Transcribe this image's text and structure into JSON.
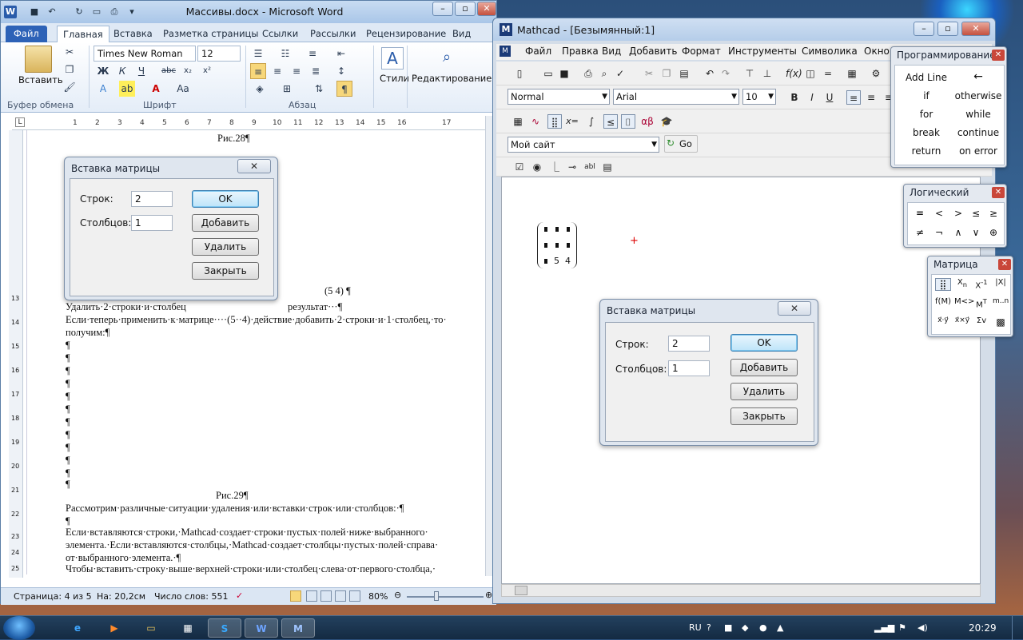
{
  "word": {
    "title": "Массивы.docx  -  Microsoft Word",
    "tabs": [
      "Файл",
      "Главная",
      "Вставка",
      "Разметка страницы",
      "Ссылки",
      "Рассылки",
      "Рецензирование",
      "Вид"
    ],
    "groups": {
      "clipboard": "Буфер обмена",
      "font": "Шрифт",
      "paragraph": "Абзац",
      "styles": "Стили",
      "editing": "Редактирование",
      "paste": "Вставить"
    },
    "font_name": "Times New Roman",
    "font_size": "12",
    "ruler_marks": [
      "1",
      "2",
      "3",
      "4",
      "5",
      "6",
      "7",
      "8",
      "9",
      "10",
      "11",
      "12",
      "13",
      "14",
      "15",
      "16",
      "17"
    ],
    "vruler_marks": [
      "13",
      "14",
      "15",
      "16",
      "17",
      "18",
      "19",
      "20",
      "21",
      "22",
      "23",
      "24",
      "25"
    ],
    "doc": {
      "fig28": "Рис.28¶",
      "matrix_expr": "(5  4)  ¶",
      "line_delete": "Удалить·2·строки·и·столбец",
      "line_result": "результат···¶",
      "line_apply": "Если·теперь·применить·к·матрице····(5··4)·действие·добавить·2·строки·и·1·столбец,·то·",
      "line_get": "получим:¶",
      "empty_para": "¶",
      "fig29": "Рис.29¶",
      "p1": "Рассмотрим·различные·ситуации·удаления·или·вставки·строк·или·столбцов:·¶",
      "p2a": "Если·вставляются·строки,·Mathcad·создает·строки·пустых·полей·ниже·выбранного·",
      "p2b": "элемента.·Если·вставляются·столбцы,·Mathcad·создает·столбцы·пустых·полей·справа·",
      "p2c": "от·выбранного·элемента.·¶",
      "p3": "Чтобы·вставить·строку·выше·верхней·строки·или·столбец·слева·от·первого·столбца,·"
    },
    "status": {
      "page": "Страница: 4 из 5",
      "pos": "На: 20,2см",
      "words": "Число слов: 551",
      "zoom": "80%"
    }
  },
  "word_dialog": {
    "title": "Вставка матрицы",
    "rows_label": "Строк:",
    "rows_value": "2",
    "cols_label": "Столбцов:",
    "cols_value": "1",
    "ok": "OK",
    "add": "Добавить",
    "delete": "Удалить",
    "close": "Закрыть"
  },
  "mathcad": {
    "title": "Mathcad - [Безымянный:1]",
    "menu": [
      "Файл",
      "Правка",
      "Вид",
      "Добавить",
      "Формат",
      "Инструменты",
      "Символика",
      "Окно"
    ],
    "style_value": "Normal",
    "font_value": "Arial",
    "size_value": "10",
    "site_value": "Мой сайт",
    "go_label": "Go",
    "matrix_vals": [
      "5",
      "4"
    ]
  },
  "mathcad_dialog": {
    "title": "Вставка матрицы",
    "rows_label": "Строк:",
    "rows_value": "2",
    "cols_label": "Столбцов:",
    "cols_value": "1",
    "ok": "OK",
    "add": "Добавить",
    "delete": "Удалить",
    "close": "Закрыть"
  },
  "prog_palette": {
    "title": "Программирование",
    "items": [
      "Add Line",
      "←",
      "if",
      "otherwise",
      "for",
      "while",
      "break",
      "continue",
      "return",
      "on error"
    ]
  },
  "logic_palette": {
    "title": "Логический",
    "items": [
      "=",
      "<",
      ">",
      "≤",
      "≥",
      "≠",
      "¬",
      "∧",
      "∨",
      "⊕"
    ]
  },
  "matrix_palette": {
    "title": "Матрица"
  },
  "taskbar": {
    "lang": "RU",
    "clock": "20:29"
  }
}
